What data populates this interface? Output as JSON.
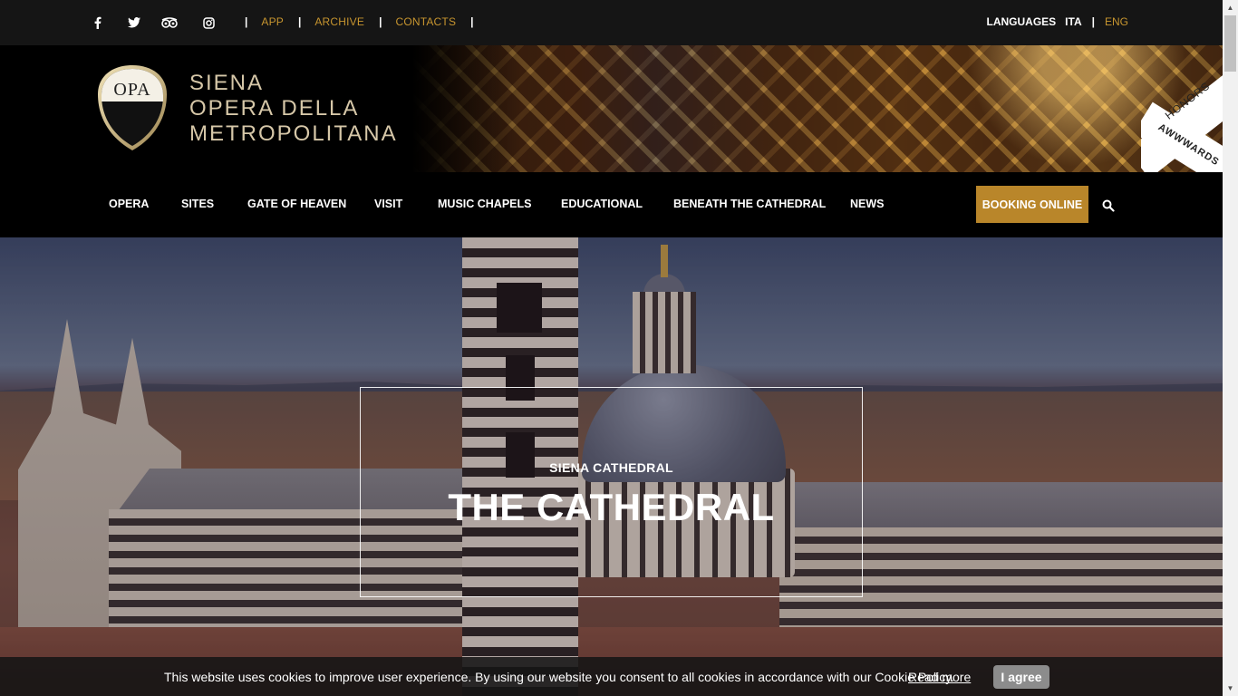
{
  "topbar": {
    "social": [
      {
        "name": "facebook-icon"
      },
      {
        "name": "twitter-icon"
      },
      {
        "name": "tripadvisor-icon"
      },
      {
        "name": "instagram-icon"
      }
    ],
    "links": [
      "APP",
      "ARCHIVE",
      "CONTACTS"
    ],
    "separator": "|",
    "languages_label": "LANGUAGES",
    "lang_ita": "ITA",
    "lang_eng": "ENG"
  },
  "header": {
    "logo_text": "OPA",
    "title_lines": [
      "SIENA",
      "OPERA DELLA",
      "METROPOLITANA"
    ],
    "awards_top": "HONORS",
    "awards_bottom": "AWWWARDS"
  },
  "nav": {
    "items": [
      "OPERA",
      "SITES",
      "GATE OF HEAVEN",
      "VISIT",
      "MUSIC CHAPELS",
      "EDUCATIONAL",
      "BENEATH THE CATHEDRAL",
      "NEWS"
    ],
    "booking": "BOOKING ONLINE"
  },
  "hero": {
    "subtitle": "SIENA CATHEDRAL",
    "title": "THE CATHEDRAL"
  },
  "cookie": {
    "text": "This website uses cookies to improve user experience. By using our website you consent to all cookies in accordance with our Cookie Policy.",
    "link": "Read more",
    "button": "I agree"
  },
  "colors": {
    "accent_gold": "#c7952f",
    "booking_bg": "#b9862a",
    "topbar_bg": "#151515"
  }
}
